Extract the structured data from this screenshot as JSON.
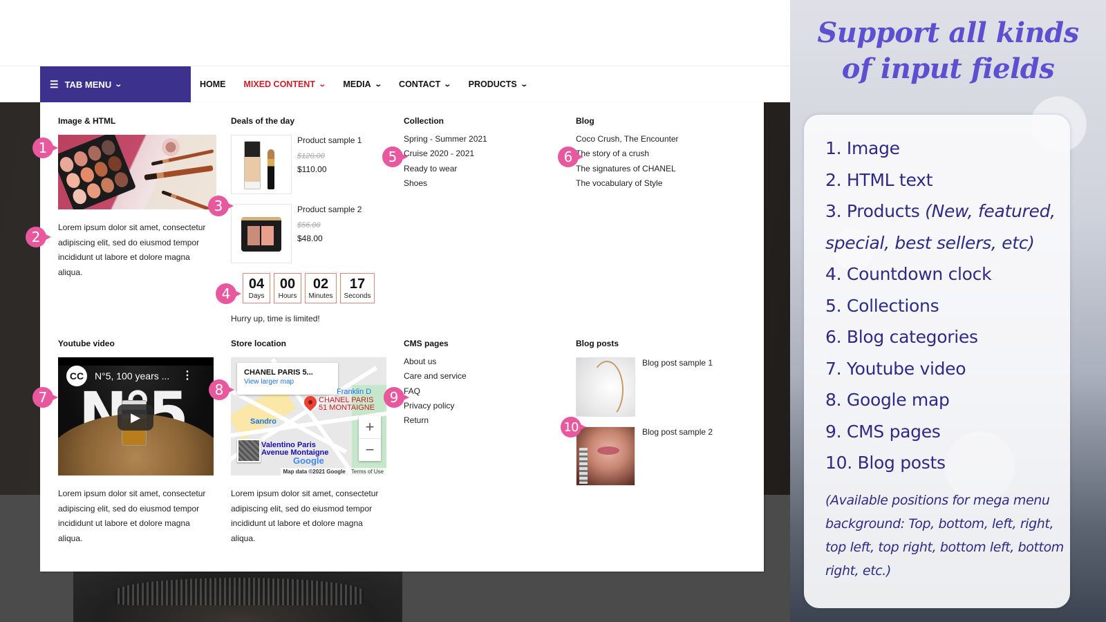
{
  "nav": {
    "tab_menu_label": "TAB MENU",
    "items": [
      {
        "label": "HOME",
        "has_dropdown": false,
        "active": false
      },
      {
        "label": "MIXED CONTENT",
        "has_dropdown": true,
        "active": true
      },
      {
        "label": "MEDIA",
        "has_dropdown": true,
        "active": false
      },
      {
        "label": "CONTACT",
        "has_dropdown": true,
        "active": false
      },
      {
        "label": "PRODUCTS",
        "has_dropdown": true,
        "active": false
      }
    ],
    "colors": {
      "tab_menu_bg": "#3d318e",
      "active_item": "#cc1f2a"
    }
  },
  "mega_menu": {
    "image_html": {
      "title": "Image & HTML",
      "image_alt": "cosmetics-flatlay",
      "text": "Lorem ipsum dolor sit amet, consectetur adipiscing elit, sed do eiusmod tempor incididunt ut labore et dolore magna aliqua."
    },
    "deals": {
      "title": "Deals of the day",
      "products": [
        {
          "name": "Product sample 1",
          "old_price": "$120.00",
          "price": "$110.00"
        },
        {
          "name": "Product sample 2",
          "old_price": "$56.00",
          "price": "$48.00"
        }
      ],
      "countdown": [
        {
          "value": "04",
          "label": "Days"
        },
        {
          "value": "00",
          "label": "Hours"
        },
        {
          "value": "02",
          "label": "Minutes"
        },
        {
          "value": "17",
          "label": "Seconds"
        }
      ],
      "countdown_note": "Hurry up, time is limited!"
    },
    "collection": {
      "title": "Collection",
      "links": [
        "Spring - Summer 2021",
        "Cruise 2020 - 2021",
        "Ready to wear",
        "Shoes"
      ]
    },
    "blog": {
      "title": "Blog",
      "links": [
        "Coco Crush, The Encounter",
        "The story of a crush",
        "The signatures of CHANEL",
        "The vocabulary of Style"
      ]
    },
    "youtube": {
      "title": "Youtube video",
      "video_title": "N°5, 100 years ...",
      "channel_logo": "CC",
      "thumbnail_text": "N°5",
      "text": "Lorem ipsum dolor sit amet, consectetur adipiscing elit, sed do eiusmod tempor incididunt ut labore et dolore magna aliqua."
    },
    "store": {
      "title": "Store location",
      "map_card_title": "CHANEL PARIS 5...",
      "map_card_link": "View larger map",
      "labels": {
        "pin": "CHANEL PARIS\n51 MONTAIGNE",
        "metro": "Franklin D",
        "shop": "Sandro",
        "place": "Valentino Paris\nAvenue Montaigne",
        "google": "Google"
      },
      "zoom_in": "+",
      "zoom_out": "−",
      "map_data": "Map data ©2021 Google",
      "terms": "Terms of Use",
      "text": "Lorem ipsum dolor sit amet, consectetur adipiscing elit, sed do eiusmod tempor incididunt ut labore et dolore magna aliqua."
    },
    "cms": {
      "title": "CMS pages",
      "links": [
        "About us",
        "Care and service",
        "FAQ",
        "Privacy policy",
        "Return"
      ]
    },
    "blog_posts": {
      "title": "Blog posts",
      "posts": [
        {
          "name": "Blog post sample 1"
        },
        {
          "name": "Blog post sample 2"
        }
      ]
    }
  },
  "markers": [
    "1",
    "2",
    "3",
    "4",
    "5",
    "6",
    "7",
    "8",
    "9",
    "10"
  ],
  "promo": {
    "title_line1": "Support all kinds",
    "title_line2": "of input fields",
    "features": [
      {
        "num": "1.",
        "text": "Image"
      },
      {
        "num": "2.",
        "text": "HTML text"
      },
      {
        "num": "3.",
        "text": "Products",
        "note": "(New, featured,"
      },
      {
        "text_cont": "special, best sellers, etc)"
      },
      {
        "num": "4.",
        "text": "Countdown clock"
      },
      {
        "num": "5.",
        "text": "Collections"
      },
      {
        "num": "6.",
        "text": "Blog categories"
      },
      {
        "num": "7.",
        "text": "Youtube video"
      },
      {
        "num": "8.",
        "text": "Google map"
      },
      {
        "num": "9.",
        "text": "CMS pages"
      },
      {
        "num": "10.",
        "text": "Blog posts"
      }
    ],
    "note": "(Available positions for mega menu background: Top, bottom, left, right, top left, top right, bottom left, bottom right, etc.)",
    "colors": {
      "title": "#5d4fcf",
      "text": "#2f2a85"
    }
  }
}
